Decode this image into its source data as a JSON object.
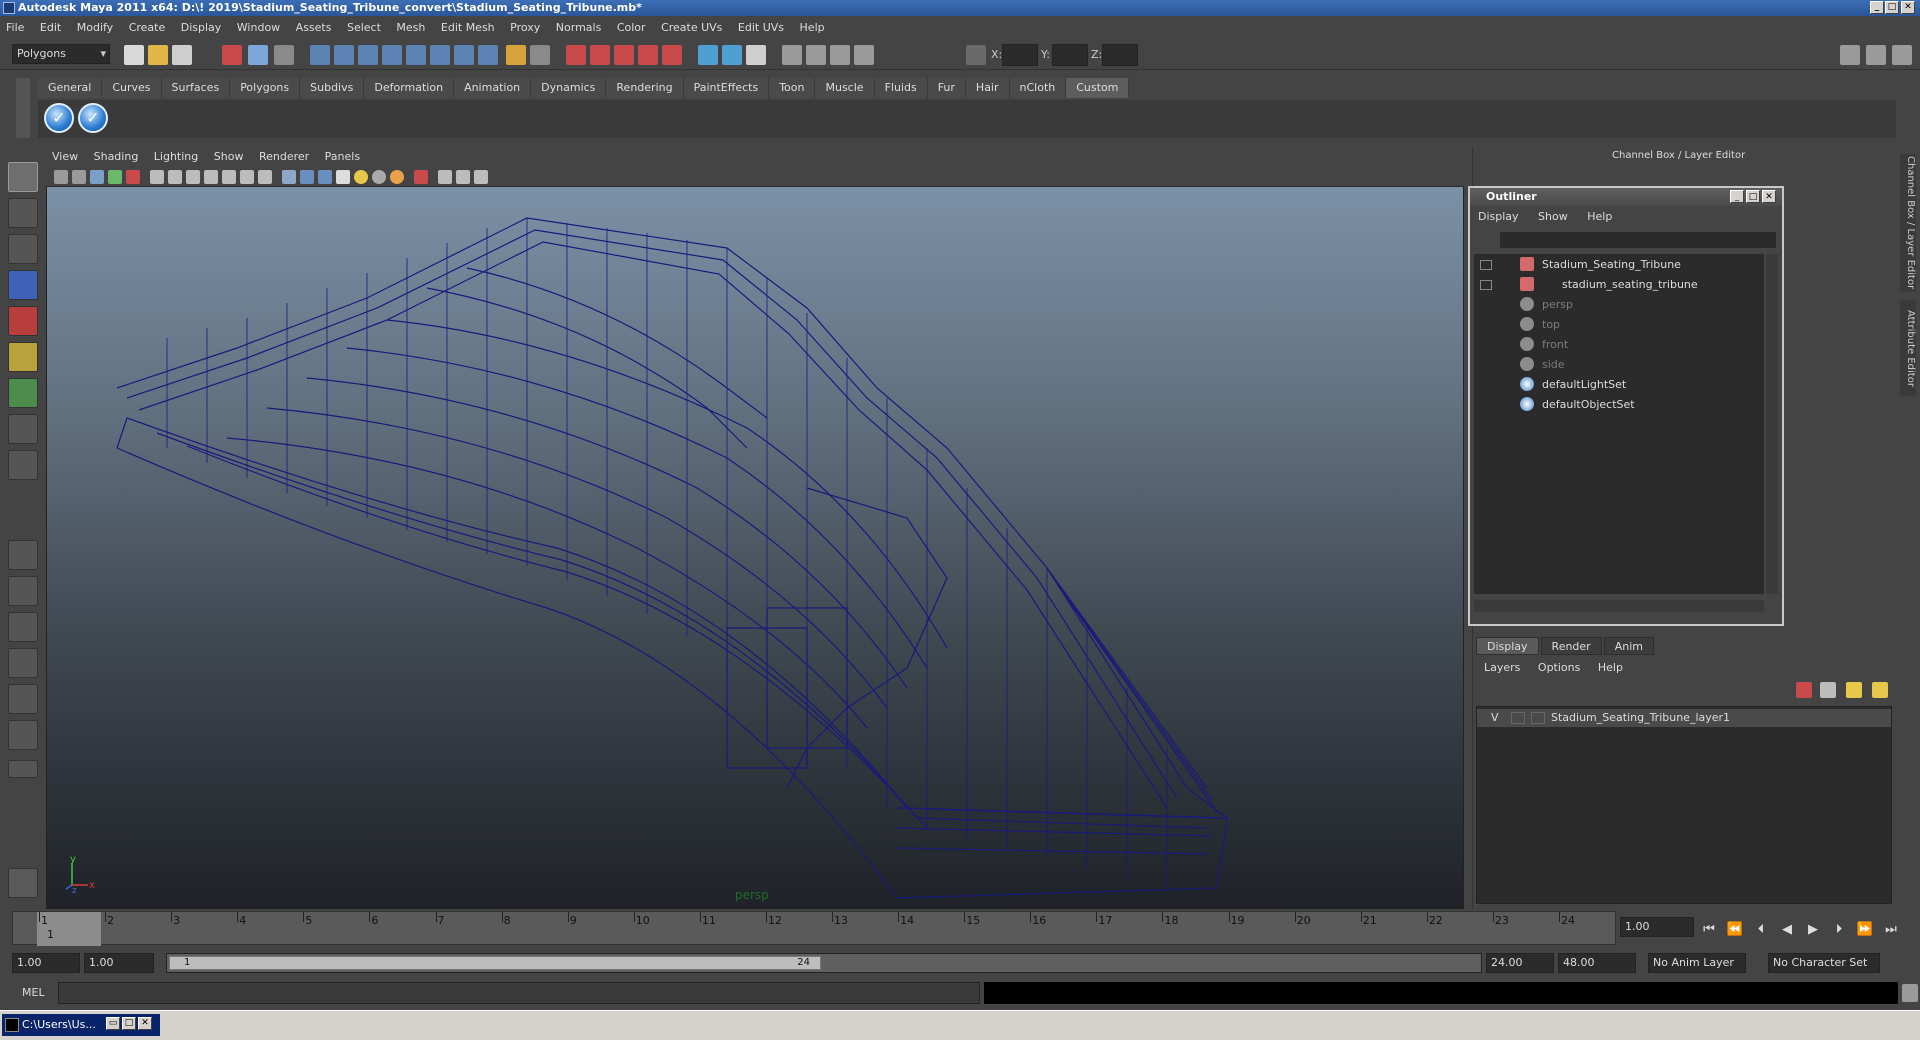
{
  "window": {
    "title": "Autodesk Maya 2011 x64: D:\\! 2019\\Stadium_Seating_Tribune_convert\\Stadium_Seating_Tribune.mb*"
  },
  "menubar": [
    "File",
    "Edit",
    "Modify",
    "Create",
    "Display",
    "Window",
    "Assets",
    "Select",
    "Mesh",
    "Edit Mesh",
    "Proxy",
    "Normals",
    "Color",
    "Create UVs",
    "Edit UVs",
    "Help"
  ],
  "statusline": {
    "mode": "Polygons",
    "x_label": "X:",
    "y_label": "Y:",
    "z_label": "Z:"
  },
  "shelf": {
    "tabs": [
      "General",
      "Curves",
      "Surfaces",
      "Polygons",
      "Subdivs",
      "Deformation",
      "Animation",
      "Dynamics",
      "Rendering",
      "PaintEffects",
      "Toon",
      "Muscle",
      "Fluids",
      "Fur",
      "Hair",
      "nCloth",
      "Custom"
    ],
    "active_tab": "Custom",
    "buttons": [
      "check-icon",
      "check-icon"
    ]
  },
  "viewport": {
    "menu": [
      "View",
      "Shading",
      "Lighting",
      "Show",
      "Renderer",
      "Panels"
    ],
    "camera_label": "persp",
    "axis": {
      "y": "y",
      "x": "x",
      "z": "z"
    },
    "wire_color": "#1a1a7a"
  },
  "right_panel": {
    "title": "Channel Box / Layer Editor",
    "side_tabs": [
      "Channel Box / Layer Editor",
      "Attribute Editor"
    ]
  },
  "outliner": {
    "title": "Outliner",
    "menu": [
      "Display",
      "Show",
      "Help"
    ],
    "items": [
      {
        "label": "Stadium_Seating_Tribune",
        "dim": false
      },
      {
        "label": "stadium_seating_tribune",
        "dim": false
      },
      {
        "label": "persp",
        "dim": true
      },
      {
        "label": "top",
        "dim": true
      },
      {
        "label": "front",
        "dim": true
      },
      {
        "label": "side",
        "dim": true
      },
      {
        "label": "defaultLightSet",
        "dim": false
      },
      {
        "label": "defaultObjectSet",
        "dim": false
      }
    ]
  },
  "layer_editor": {
    "tabs": [
      "Display",
      "Render",
      "Anim"
    ],
    "active_tab": "Display",
    "menu": [
      "Layers",
      "Options",
      "Help"
    ],
    "layers": [
      {
        "visible": "V",
        "name": "Stadium_Seating_Tribune_layer1"
      }
    ]
  },
  "timeline": {
    "ticks": [
      "1",
      "2",
      "3",
      "4",
      "5",
      "6",
      "7",
      "8",
      "9",
      "10",
      "11",
      "12",
      "13",
      "14",
      "15",
      "16",
      "17",
      "18",
      "19",
      "20",
      "21",
      "22",
      "23",
      "24"
    ],
    "current_frame": "1",
    "current_time": "1.00"
  },
  "range": {
    "start": "1.00",
    "anim_start": "1.00",
    "range_start": "1",
    "range_end": "24",
    "anim_end": "24.00",
    "end": "48.00",
    "anim_layer": "No Anim Layer",
    "char_set": "No Character Set"
  },
  "cmdline": {
    "label": "MEL"
  },
  "taskbar": {
    "item": "C:\\Users\\Us..."
  }
}
